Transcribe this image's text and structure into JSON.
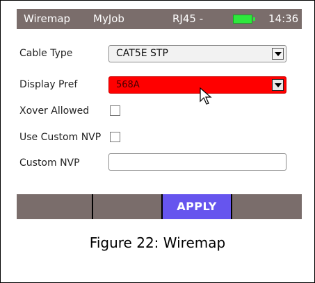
{
  "status_bar": {
    "screen_title": "Wiremap",
    "job_name": "MyJob",
    "port": "RJ45 -",
    "battery_icon": "battery-icon",
    "battery_color": "#2ee83d",
    "time": "14:36"
  },
  "settings": {
    "cable_type": {
      "label": "Cable Type",
      "value": "CAT5E STP"
    },
    "display_pref": {
      "label": "Display Pref",
      "value": "568A",
      "highlight_color": "#ff0000"
    },
    "xover_allowed": {
      "label": "Xover Allowed",
      "checked": false
    },
    "use_custom_nvp": {
      "label": "Use Custom NVP",
      "checked": false
    },
    "custom_nvp": {
      "label": "Custom NVP",
      "value": ""
    }
  },
  "buttons": {
    "apply_label": "APPLY",
    "apply_color": "#6655ee"
  },
  "cursor_icon": "pointer-cursor-icon",
  "caption": "Figure 22: Wiremap"
}
